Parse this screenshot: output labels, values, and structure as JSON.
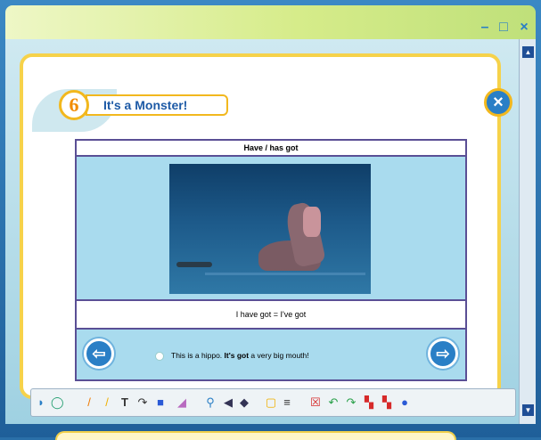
{
  "window": {
    "minimize": "–",
    "maximize": "□",
    "close": "×"
  },
  "unit": {
    "number": "6",
    "title": "It's a Monster!",
    "close_symbol": "×"
  },
  "panel": {
    "heading": "Have / has got",
    "sentence": "I have got = I've got",
    "caption_pre": "This is a hippo. ",
    "caption_bold": "It's got",
    "caption_post": " a very big mouth!",
    "nav_prev": "⇦",
    "nav_next": "⇨"
  },
  "controls": [
    "home-icon",
    "audio-icon",
    "video-icon",
    "game-icon",
    "grid-icon",
    "record-icon",
    "stop-icon",
    "mouse-icon",
    "screen-icon"
  ],
  "toolbar_tools": [
    "pointer-icon",
    "lasso-icon",
    "pen-icon",
    "highlighter-icon",
    "text-icon",
    "curve-icon",
    "shape-icon",
    "eraser-icon",
    "zoom-icon",
    "reveal-icon",
    "spotlight-icon",
    "select-icon",
    "delete-icon",
    "undo-icon",
    "redo-icon",
    "bookmark-red-icon",
    "bookmark-red-icon-2",
    "help-icon"
  ],
  "toolbar_text_glyph": "T"
}
